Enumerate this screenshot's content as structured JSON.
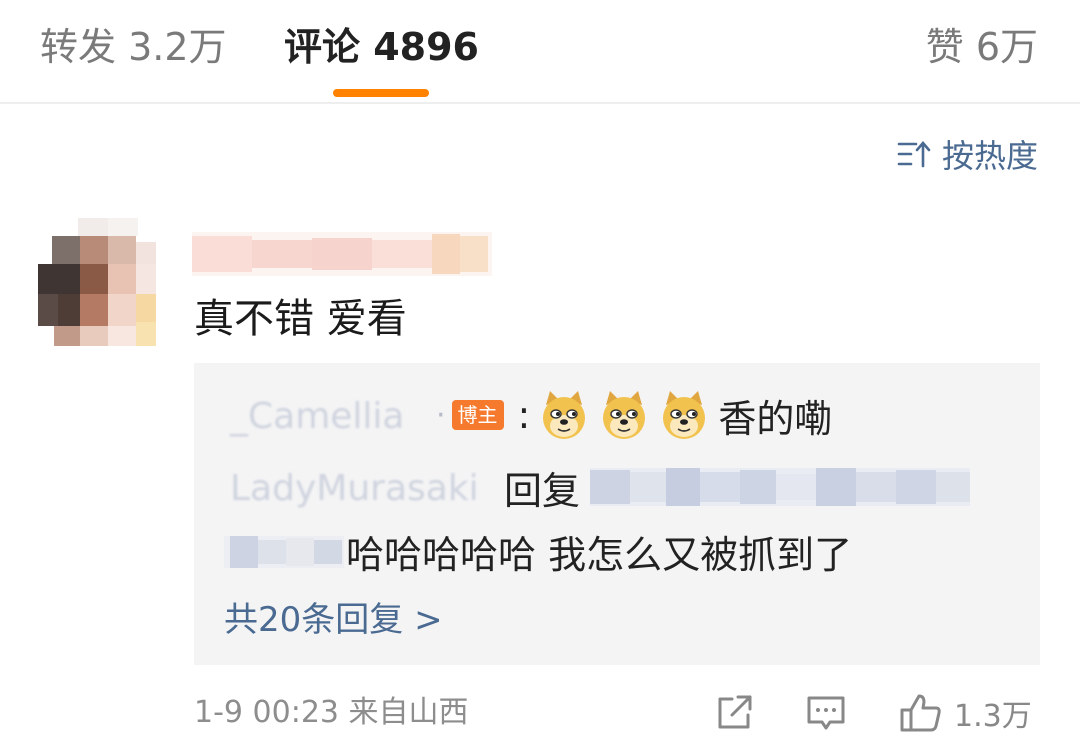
{
  "tabs": {
    "repost_label": "转发 3.2万",
    "comment_label": "评论 4896",
    "like_label": "赞 6万"
  },
  "sort": {
    "label": "按热度",
    "icon": "sort-icon"
  },
  "comment": {
    "text": "真不错 爱看",
    "replies": [
      {
        "author_visible": "_Camellia",
        "badge": "博主",
        "separator": "·",
        "colon": ":",
        "emoji_count": 3,
        "emoji": "doge",
        "text": "香的嘞"
      },
      {
        "author_visible": "LadyMurasaki",
        "verb": "回复",
        "text": "哈哈哈哈哈 我怎么又被抓到了"
      }
    ],
    "more_replies": "共20条回复 >",
    "meta": "1-9 00:23 来自山西",
    "like_count": "1.3万"
  },
  "colors": {
    "accent": "#ff8200",
    "link": "#4a6a91",
    "badge": "#f57a2d",
    "reply_bg": "#f4f4f5"
  }
}
